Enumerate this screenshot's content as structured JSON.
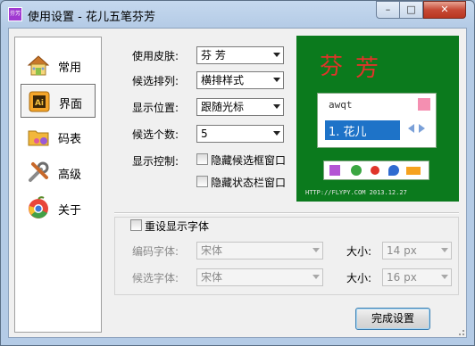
{
  "window": {
    "title": "使用设置 - 花儿五笔芬芳",
    "app_icon": "芬芳",
    "min_label": "–",
    "max_label": "□",
    "close_label": "✕"
  },
  "nav": {
    "items": [
      {
        "label": "常用",
        "icon": "house-icon"
      },
      {
        "label": "界面",
        "icon": "interface-icon",
        "selected": true
      },
      {
        "label": "码表",
        "icon": "folder-icon"
      },
      {
        "label": "高级",
        "icon": "tools-icon"
      },
      {
        "label": "关于",
        "icon": "chrome-icon"
      }
    ]
  },
  "settings": {
    "skin_label": "使用皮肤:",
    "skin_value": "芬 芳",
    "layout_label": "候选排列:",
    "layout_value": "横排样式",
    "position_label": "显示位置:",
    "position_value": "跟随光标",
    "count_label": "候选个数:",
    "count_value": "5",
    "control_label": "显示控制:",
    "hide_candidate_label": "隐藏候选框窗口",
    "hide_status_label": "隐藏状态栏窗口"
  },
  "preview": {
    "title_char1": "芬",
    "title_char2": "芳",
    "code": "awqt",
    "candidate": "1. 花儿",
    "footer": "HTTP://FLYPY.COM  2013.12.27",
    "colors": {
      "bg": "#0b7a1d",
      "title": "#e0342a",
      "highlight": "#1e73c8"
    }
  },
  "font": {
    "reset_label": "重设显示字体",
    "code_font_label": "编码字体:",
    "code_font_value": "宋体",
    "cand_font_label": "候选字体:",
    "cand_font_value": "宋体",
    "size_label": "大小:",
    "code_size_value": "14 px",
    "cand_size_value": "16 px"
  },
  "buttons": {
    "done_label": "完成设置"
  }
}
